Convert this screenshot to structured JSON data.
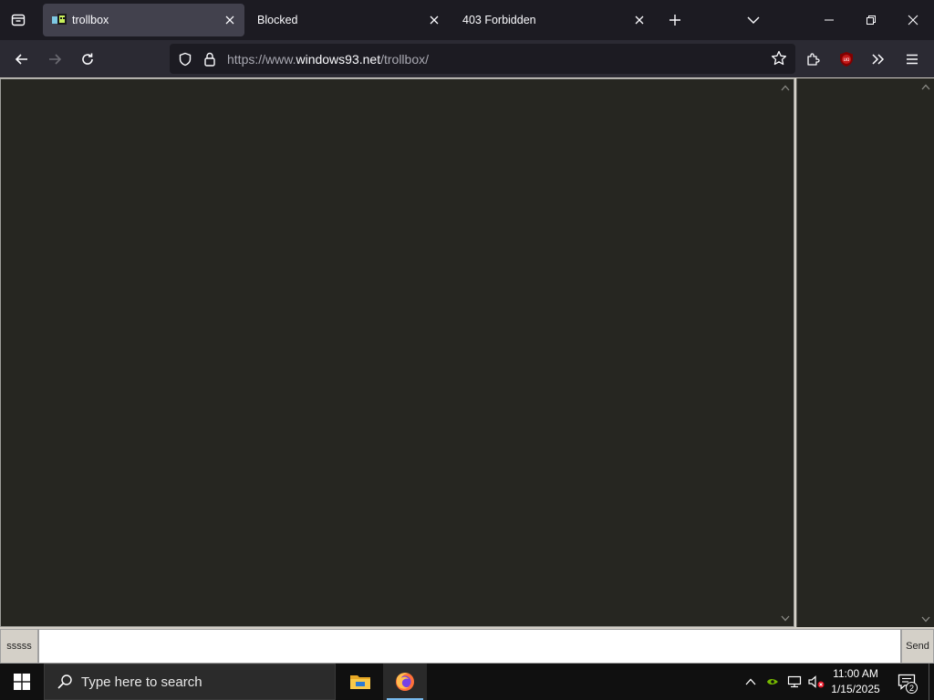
{
  "browser": {
    "tabs": [
      {
        "title": "trollbox",
        "active": true
      },
      {
        "title": "Blocked",
        "active": false
      },
      {
        "title": "403 Forbidden",
        "active": false
      }
    ],
    "url": {
      "scheme": "https://www.",
      "host": "windows93.net",
      "path": "/trollbox/"
    },
    "ublock_badge": "uo"
  },
  "chat": {
    "nickname": "sssss",
    "message_value": "",
    "send_label": "Send"
  },
  "taskbar": {
    "search_placeholder": "Type here to search",
    "time": "11:00 AM",
    "date": "1/15/2025",
    "notification_count": "2"
  },
  "colors": {
    "chat_background": "#262621",
    "accent": "#76b9ed"
  }
}
